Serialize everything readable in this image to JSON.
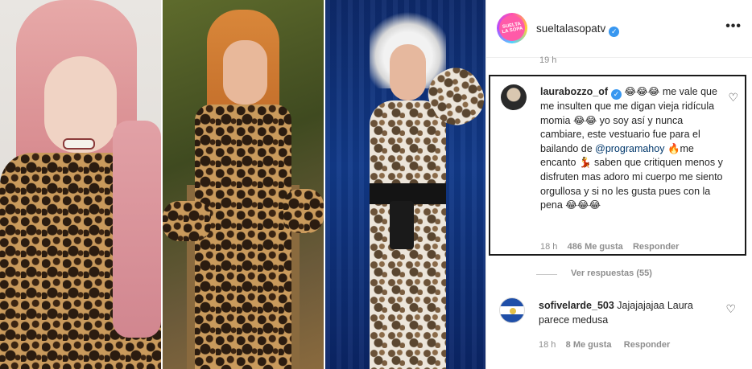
{
  "colors": {
    "mention": "#00376b",
    "verified": "#3897f0",
    "muted": "#8e8e8e",
    "text": "#262626"
  },
  "header": {
    "username": "sueltalasopatv",
    "logo_text": "SUELTA LA SOPA",
    "more_label": "•••"
  },
  "previous_comment": {
    "time": "19 h"
  },
  "featured_comment": {
    "username": "laurabozzo_of",
    "text_part1": "😂😂😂 me vale que me insulten que me digan vieja ridícula momia 😂😂 yo soy así y nunca cambiare, este vestuario fue para el bailando de ",
    "mention": "@programahoy",
    "text_part2": " 🔥me encanto 💃 saben que critiquen menos y disfruten mas adoro mi cuerpo me siento orgullosa y si no les gusta pues con la pena 😂😂😂",
    "time": "18 h",
    "likes": "486 Me gusta",
    "reply_label": "Responder"
  },
  "view_replies": "Ver respuestas (55)",
  "second_comment": {
    "username": "sofivelarde_503",
    "text": " Jajajajajaa Laura parece medusa",
    "time": "18 h",
    "likes": "8 Me gusta",
    "reply_label": "Responder"
  },
  "icons": {
    "like": "heart-outline-icon",
    "more": "more-horizontal-icon",
    "verified": "verified-badge-icon"
  }
}
